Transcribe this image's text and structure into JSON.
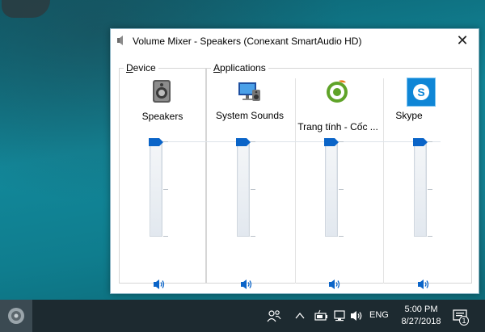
{
  "window": {
    "title": "Volume Mixer - Speakers (Conexant SmartAudio HD)",
    "close_glyph": "✕"
  },
  "groups": {
    "device_legend_first": "D",
    "device_legend_rest": "evice",
    "apps_legend_first": "A",
    "apps_legend_rest": "pplications"
  },
  "channels": [
    {
      "label": "Speakers",
      "icon": "speaker-device-icon",
      "volume": 100,
      "muted": false
    },
    {
      "label": "System Sounds",
      "icon": "system-sounds-icon",
      "volume": 100,
      "muted": false
    },
    {
      "label": "Trang tính - Cốc ...",
      "icon": "coccoc-browser-icon",
      "volume": 100,
      "muted": false
    },
    {
      "label": "Skype",
      "icon": "skype-icon",
      "volume": 100,
      "muted": false
    }
  ],
  "taskbar": {
    "language": "ENG",
    "time": "5:00 PM",
    "date": "8/27/2018",
    "notification_count": "1"
  },
  "colors": {
    "accent": "#0a64c8",
    "taskbar": "#1d2a30"
  }
}
